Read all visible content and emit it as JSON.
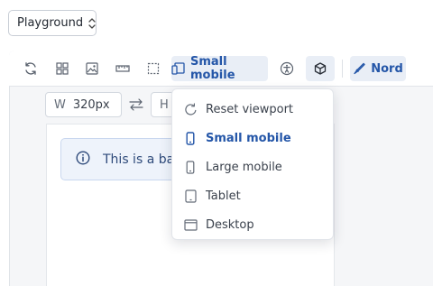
{
  "story_select": {
    "value": "Playground"
  },
  "toolbar": {
    "viewport_label": "Small mobile",
    "theme_label": "Nord"
  },
  "dimensions": {
    "width_label": "W",
    "width_value": "320px",
    "height_label": "H"
  },
  "preview": {
    "alert_text": "This is a basic alert"
  },
  "viewport_menu": {
    "items": [
      {
        "label": "Reset viewport",
        "icon": "reset-icon"
      },
      {
        "label": "Small mobile",
        "icon": "mobile-icon",
        "selected": true
      },
      {
        "label": "Large mobile",
        "icon": "mobile-icon"
      },
      {
        "label": "Tablet",
        "icon": "tablet-icon"
      },
      {
        "label": "Desktop",
        "icon": "desktop-icon"
      }
    ]
  },
  "colors": {
    "accent": "#2456a8",
    "active_bg": "#e9eef6",
    "alert_bg": "#eef3fb"
  }
}
